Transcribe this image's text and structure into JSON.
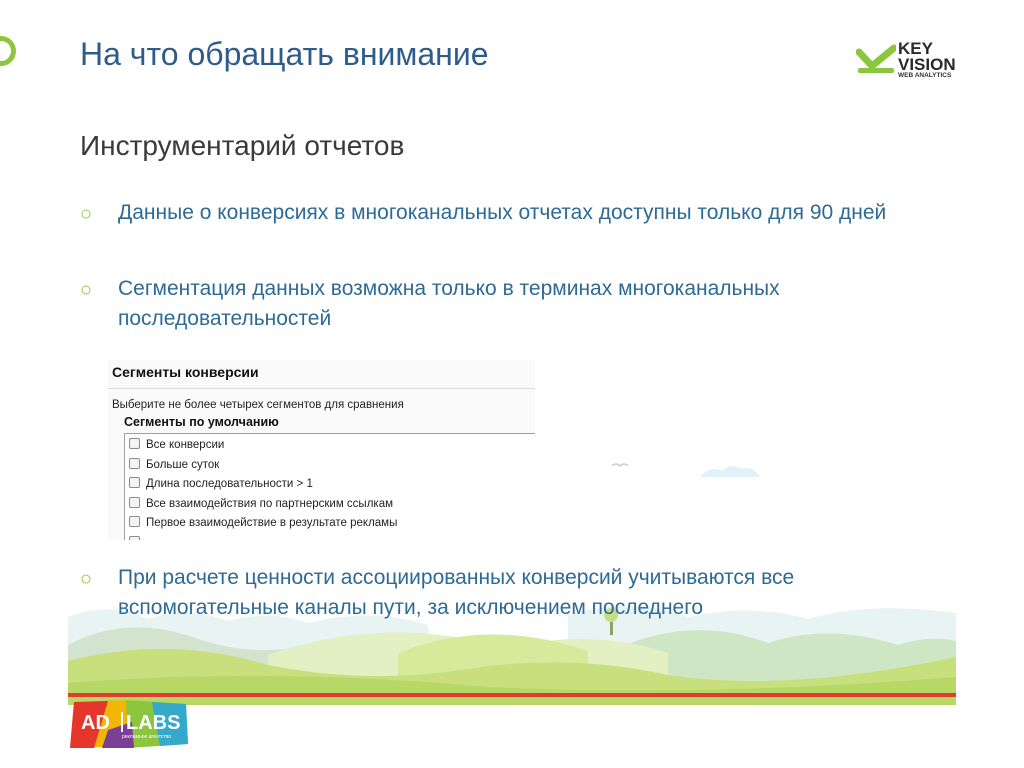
{
  "header": {
    "title": "На что обращать внимание",
    "logo": {
      "line1": "KEY",
      "line2": "VISION",
      "line3": "WEB ANALYTICS"
    }
  },
  "content": {
    "subtitle": "Инструментарий отчетов",
    "bullet_marker": "○",
    "bullets": [
      "Данные о конверсиях в многоканальных отчетах доступны только для 90 дней",
      "Сегментация данных возможна только в терминах многоканальных последовательностей",
      "При расчете ценности ассоциированных конверсий учитываются все вспомогательные каналы пути, за исключением последнего"
    ]
  },
  "embedded_screenshot": {
    "title": "Сегменты конверсии",
    "hint": "Выберите не более четырех сегментов для сравнения",
    "group_label": "Сегменты по умолчанию",
    "segments": [
      {
        "label": "Все конверсии",
        "checked": false
      },
      {
        "label": "Больше суток",
        "checked": false
      },
      {
        "label": "Длина последовательности > 1",
        "checked": false
      },
      {
        "label": "Все взаимодействия по партнерским ссылкам",
        "checked": false
      },
      {
        "label": "Первое взаимодействие в результате рекламы",
        "checked": false
      }
    ]
  },
  "footer": {
    "logo_left": "AD",
    "logo_right": "LABS",
    "logo_sub": "рекламное агентство"
  },
  "colors": {
    "title": "#2e5c8a",
    "bullet_text": "#2e6a96",
    "accent_green": "#8cc63f",
    "footer_line": "#e03c31"
  }
}
